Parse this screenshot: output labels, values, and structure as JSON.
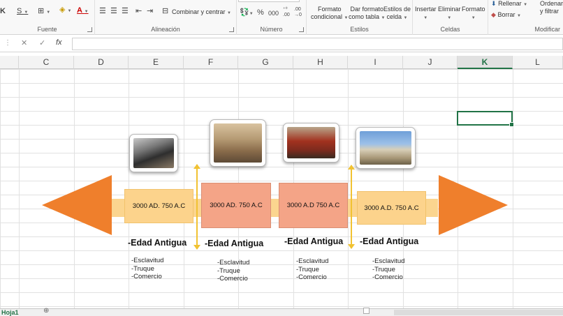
{
  "ribbon": {
    "groups": [
      {
        "label": "Fuente"
      },
      {
        "label": "Alineación"
      },
      {
        "label": "Número"
      },
      {
        "label": "Estilos"
      },
      {
        "label": "Celdas"
      },
      {
        "label": "Modificar"
      }
    ],
    "wrap_label": "Combinar y centrar",
    "percent": "%",
    "thousands": "000",
    "cond_format": [
      "Formato",
      "condicional"
    ],
    "table_format": [
      "Dar formato",
      "como tabla"
    ],
    "cell_styles": [
      "Estilos de",
      "celda"
    ],
    "insert": "Insertar",
    "delete": "Eliminar",
    "format": "Formato",
    "fill": "Rellenar",
    "clear": "Borrar",
    "sort": [
      "Ordenar",
      "y filtrar"
    ]
  },
  "formula_bar": {
    "fx": "fx",
    "value": ""
  },
  "columns": [
    "C",
    "D",
    "E",
    "F",
    "G",
    "H",
    "I",
    "J",
    "K",
    "L"
  ],
  "selected_column": "K",
  "timeline": {
    "events": [
      {
        "date": "3000 AD. 750 A.C",
        "era": "-Edad Antigua",
        "items": [
          "-Esclavitud",
          "-Truque",
          "-Comercio"
        ]
      },
      {
        "date": "3000 AD. 750 A.C",
        "era": "-Edad Antigua",
        "items": [
          "-Esclavitud",
          "-Truque",
          "-Comercio"
        ]
      },
      {
        "date": "3000 A.D 750 A.C",
        "era": "-Edad Antigua",
        "items": [
          "-Esclavitud",
          "-Truque",
          "-Comercio"
        ]
      },
      {
        "date": "3000 A.D. 750 A.C",
        "era": "-Edad Antigua",
        "items": [
          "-Esclavitud",
          "-Truque",
          "-Comercio"
        ]
      }
    ],
    "colors": {
      "arrow": "#ef7f2c",
      "band": "#fbd58f",
      "yellow_box": "#fcd38c",
      "salmon_box": "#f4a487",
      "connector": "#f1c232"
    },
    "photos": [
      "steam-train",
      "school-of-athens-painting",
      "ancient-assembly-painting",
      "parthenon"
    ]
  },
  "sheet": {
    "tab": "Hoja1"
  }
}
